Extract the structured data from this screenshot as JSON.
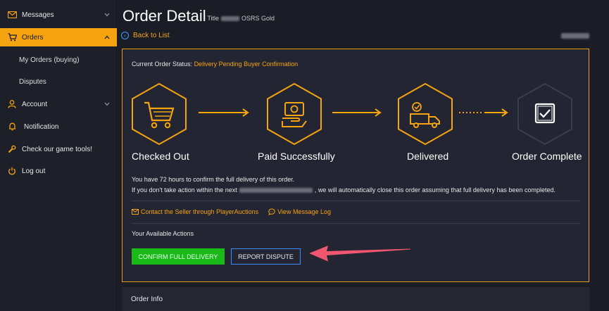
{
  "sidebar": {
    "items": [
      {
        "label": "Messages"
      },
      {
        "label": "Orders"
      },
      {
        "label": "My Orders (buying)"
      },
      {
        "label": "Disputes"
      },
      {
        "label": "Account"
      },
      {
        "label": "Notification"
      },
      {
        "label": "Check our game tools!"
      },
      {
        "label": "Log out"
      }
    ]
  },
  "header": {
    "title": "Order Detail",
    "subtitle_prefix": "- Title",
    "subtitle_game": "OSRS Gold",
    "back_label": "Back to List"
  },
  "order": {
    "status_label": "Current Order Status:",
    "status_value": "Delivery Pending Buyer Confirmation",
    "steps": [
      {
        "label": "Checked Out",
        "icon": "cart-icon"
      },
      {
        "label": "Paid Successfully",
        "icon": "payment-hand-icon"
      },
      {
        "label": "Delivered",
        "icon": "delivery-truck-icon"
      },
      {
        "label": "Order Complete",
        "icon": "checkbox-icon"
      }
    ],
    "message_line1": "You have 72 hours to confirm the full delivery of this order.",
    "message_line2_prefix": "If you don't take action within the next",
    "message_line2_suffix": ", we will automatically close this order assuming that full delivery has been completed.",
    "contact_link": "Contact the Seller through PlayerAuctions",
    "view_log_link": "View Message Log",
    "actions_label": "Your Available Actions",
    "confirm_button": "Confirm Full Delivery",
    "dispute_button": "Report Dispute"
  },
  "order_info": {
    "title": "Order Info"
  },
  "colors": {
    "accent": "#f5a30f",
    "confirm_green": "#18b918",
    "dispute_blue": "#3a8cff",
    "pointer_red": "#f0566f",
    "background": "#1b1d26"
  }
}
